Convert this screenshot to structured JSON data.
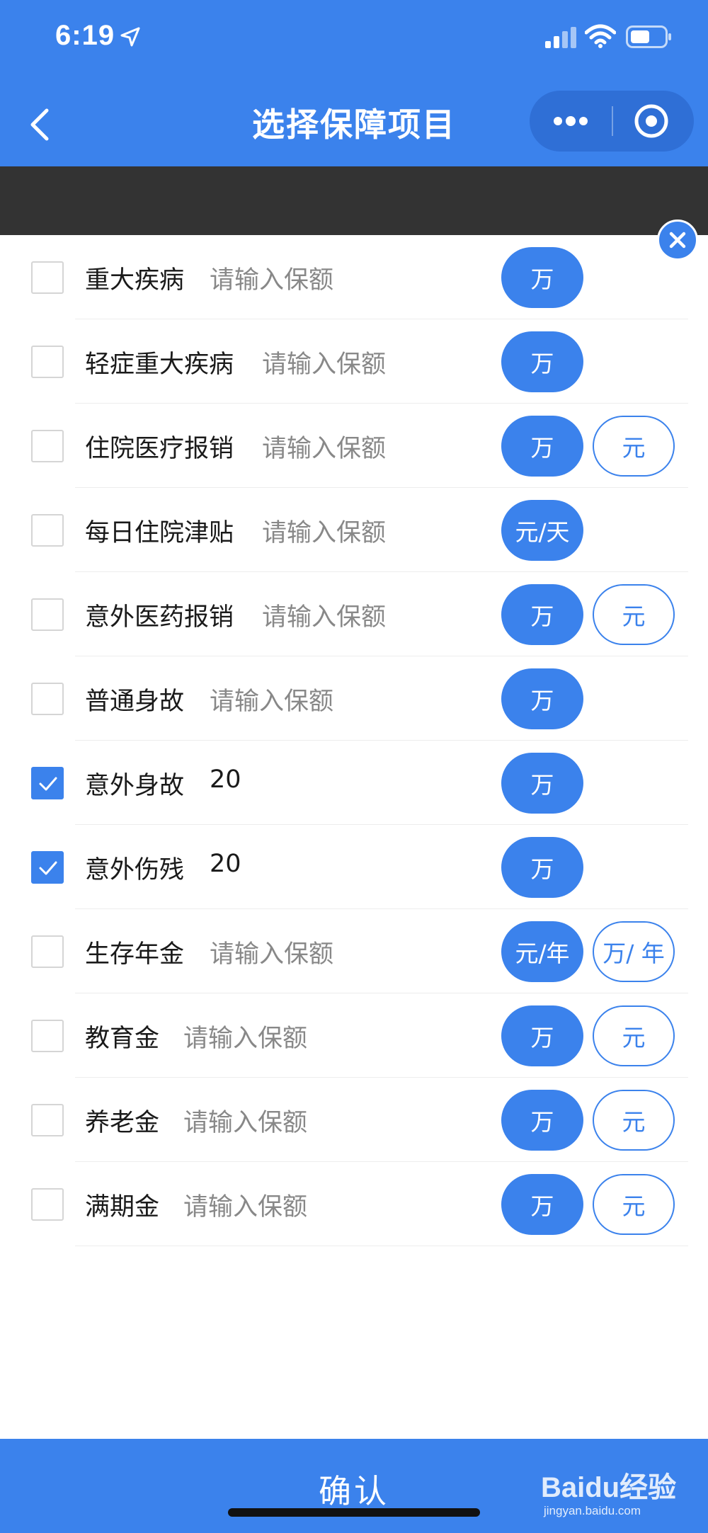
{
  "status_bar": {
    "time": "6:19"
  },
  "nav": {
    "title": "选择保障项目"
  },
  "items": [
    {
      "label": "重大疾病",
      "amount": "请输入保额",
      "checked": false,
      "units": [
        "万"
      ]
    },
    {
      "label": "轻症重大疾病",
      "amount": "请输入保额",
      "checked": false,
      "units": [
        "万"
      ]
    },
    {
      "label": "住院医疗报销",
      "amount": "请输入保额",
      "checked": false,
      "units": [
        "万",
        "元"
      ]
    },
    {
      "label": "每日住院津贴",
      "amount": "请输入保额",
      "checked": false,
      "units": [
        "元/天"
      ]
    },
    {
      "label": "意外医药报销",
      "amount": "请输入保额",
      "checked": false,
      "units": [
        "万",
        "元"
      ]
    },
    {
      "label": "普通身故",
      "amount": "请输入保额",
      "checked": false,
      "units": [
        "万"
      ]
    },
    {
      "label": "意外身故",
      "amount": "20",
      "checked": true,
      "units": [
        "万"
      ]
    },
    {
      "label": "意外伤残",
      "amount": "20",
      "checked": true,
      "units": [
        "万"
      ]
    },
    {
      "label": "生存年金",
      "amount": "请输入保额",
      "checked": false,
      "units": [
        "元/年",
        "万/ 年"
      ]
    },
    {
      "label": "教育金",
      "amount": "请输入保额",
      "checked": false,
      "units": [
        "万",
        "元"
      ]
    },
    {
      "label": "养老金",
      "amount": "请输入保额",
      "checked": false,
      "units": [
        "万",
        "元"
      ]
    },
    {
      "label": "满期金",
      "amount": "请输入保额",
      "checked": false,
      "units": [
        "万",
        "元"
      ]
    }
  ],
  "confirm_label": "确认",
  "watermark": {
    "brand": "Baidu经验",
    "url": "jingyan.baidu.com"
  },
  "colors": {
    "primary": "#3b82ec",
    "dark_band": "#333333"
  }
}
